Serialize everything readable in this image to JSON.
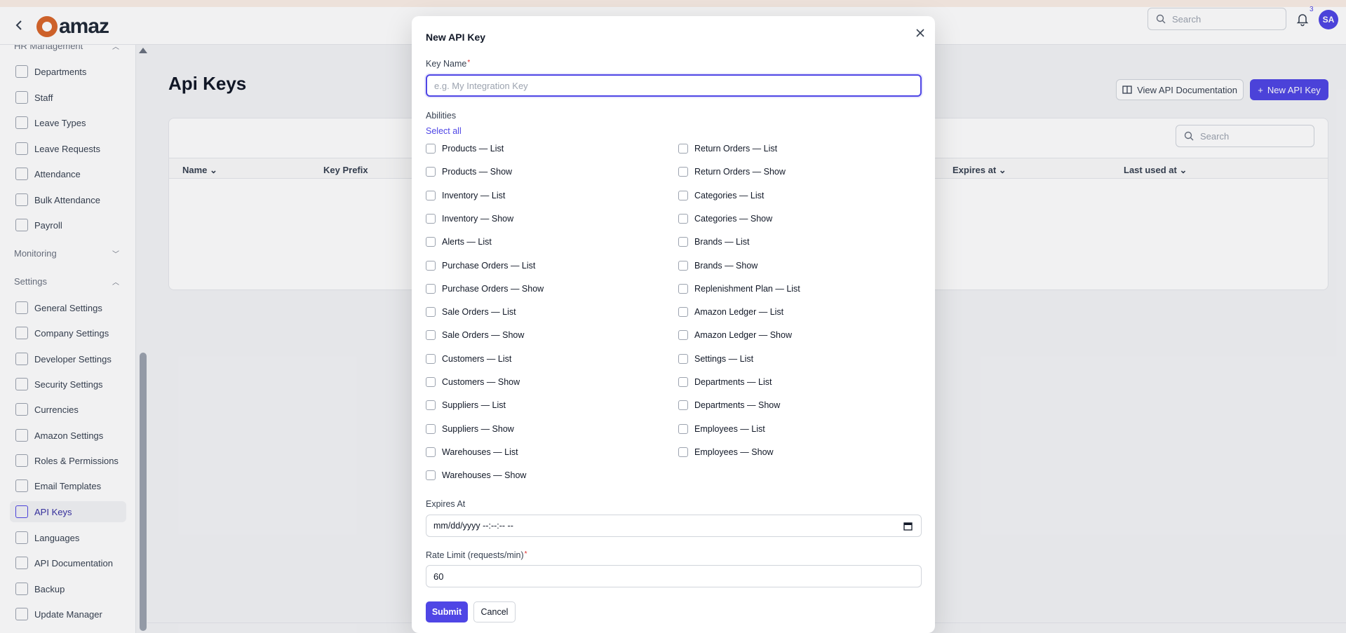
{
  "topbar": {
    "logo_text": "amaz",
    "search_placeholder": "Search",
    "notification_count": "3",
    "avatar_initials": "SA"
  },
  "sidebar": {
    "groups": [
      {
        "label": "HR Management"
      },
      {
        "label": "Monitoring"
      },
      {
        "label": "Settings"
      }
    ],
    "items": [
      {
        "label": "Departments",
        "icon": "building-icon"
      },
      {
        "label": "Staff",
        "icon": "id-card-icon"
      },
      {
        "label": "Leave Types",
        "icon": "calendar-icon"
      },
      {
        "label": "Leave Requests",
        "icon": "calendar-icon"
      },
      {
        "label": "Attendance",
        "icon": "clock-icon"
      },
      {
        "label": "Bulk Attendance",
        "icon": "users-icon"
      },
      {
        "label": "Payroll",
        "icon": "money-icon"
      },
      {
        "label": "General Settings",
        "icon": "gear-icon"
      },
      {
        "label": "Company Settings",
        "icon": "building-icon"
      },
      {
        "label": "Developer Settings",
        "icon": "terminal-icon"
      },
      {
        "label": "Security Settings",
        "icon": "shield-icon"
      },
      {
        "label": "Currencies",
        "icon": "dollar-icon"
      },
      {
        "label": "Amazon Settings",
        "icon": "cloud-icon"
      },
      {
        "label": "Roles & Permissions",
        "icon": "users-icon"
      },
      {
        "label": "Email Templates",
        "icon": "mail-icon"
      },
      {
        "label": "API Keys",
        "icon": "key-icon",
        "active": true
      },
      {
        "label": "Languages",
        "icon": "calendar-icon"
      },
      {
        "label": "API Documentation",
        "icon": "book-icon"
      },
      {
        "label": "Backup",
        "icon": "database-icon"
      },
      {
        "label": "Update Manager",
        "icon": "upload-icon"
      }
    ]
  },
  "main": {
    "title": "Api Keys",
    "view_docs_label": "View API Documentation",
    "new_key_label": "New API Key",
    "table_search_placeholder": "Search",
    "columns": [
      "Name",
      "Key Prefix",
      "Expires at",
      "Last used at"
    ]
  },
  "modal": {
    "title": "New API Key",
    "key_name_label": "Key Name",
    "key_name_placeholder": "e.g. My Integration Key",
    "key_name_value": "",
    "abilities_label": "Abilities",
    "select_all_label": "Select all",
    "abilities_left": [
      "Products — List",
      "Products — Show",
      "Inventory — List",
      "Inventory — Show",
      "Alerts — List",
      "Purchase Orders — List",
      "Purchase Orders — Show",
      "Sale Orders — List",
      "Sale Orders — Show",
      "Customers — List",
      "Customers — Show",
      "Suppliers — List",
      "Suppliers — Show",
      "Warehouses — List",
      "Warehouses — Show"
    ],
    "abilities_right": [
      "Return Orders — List",
      "Return Orders — Show",
      "Categories — List",
      "Categories — Show",
      "Brands — List",
      "Brands — Show",
      "Replenishment Plan — List",
      "Amazon Ledger — List",
      "Amazon Ledger — Show",
      "Settings — List",
      "Departments — List",
      "Departments — Show",
      "Employees — List",
      "Employees — Show"
    ],
    "expires_label": "Expires At",
    "expires_value": "mm/dd/yyyy --:--:-- --",
    "rate_limit_label": "Rate Limit (requests/min)",
    "rate_limit_value": "60",
    "submit_label": "Submit",
    "cancel_label": "Cancel"
  },
  "colors": {
    "accent": "#4f46e5",
    "required": "#dc2626"
  }
}
